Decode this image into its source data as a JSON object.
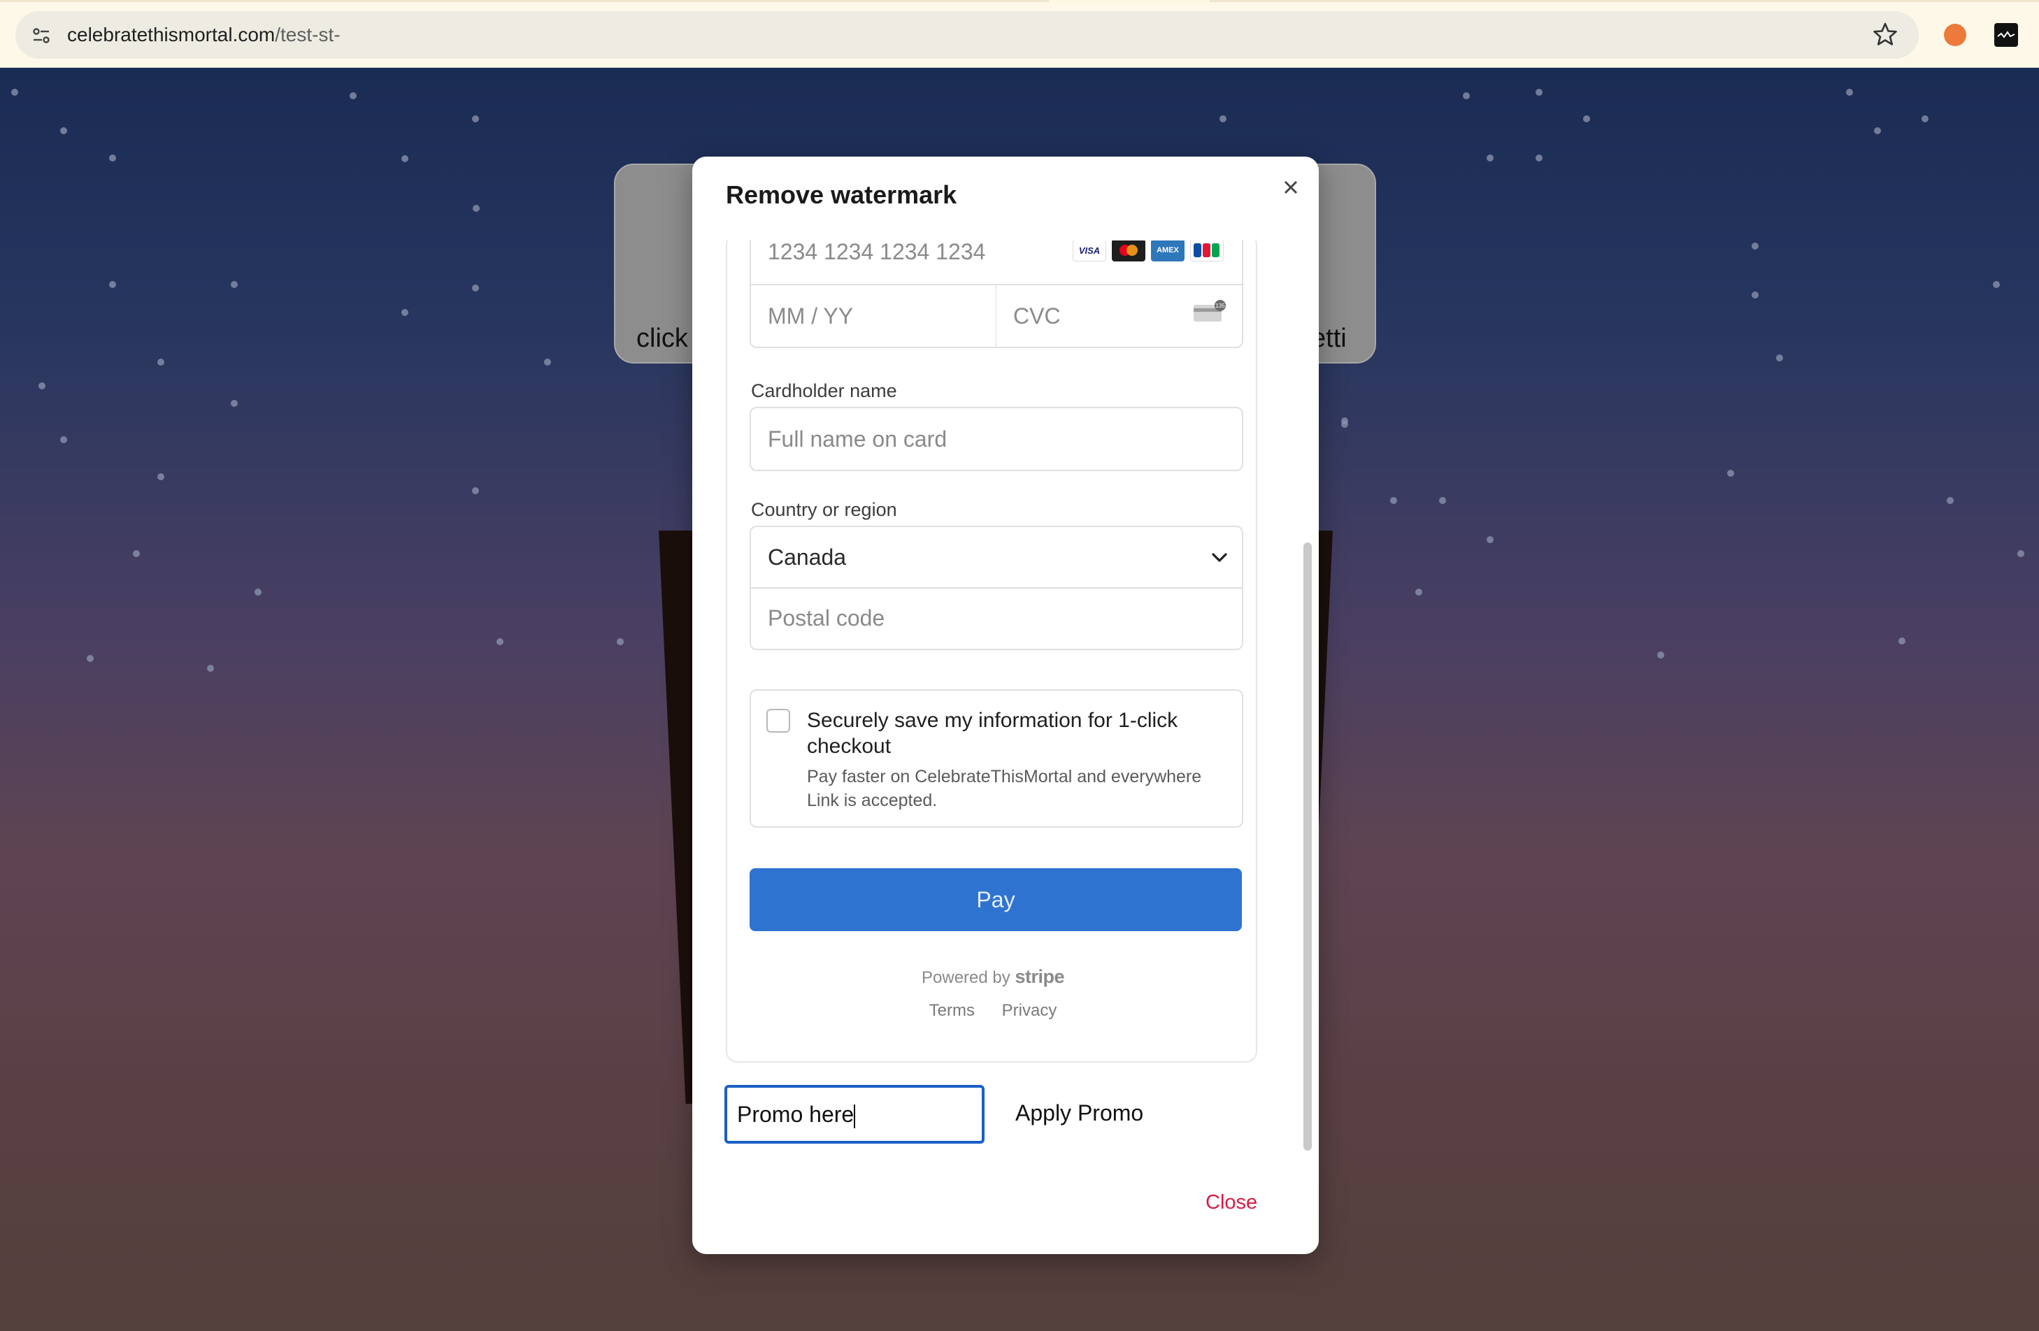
{
  "browser": {
    "url_host": "celebratethismortal.com",
    "url_path": "/test-st-",
    "icons": [
      "site-settings-icon",
      "bookmark-star-icon",
      "extension-icon",
      "extension-icon"
    ]
  },
  "background": {
    "left_text": "click",
    "right_text": "etti"
  },
  "modal": {
    "title": "Remove watermark",
    "card_number_placeholder": "1234 1234 1234 1234",
    "card_brands": [
      "VISA",
      "Mastercard",
      "AMEX",
      "JCB"
    ],
    "expiry_placeholder": "MM / YY",
    "cvc_placeholder": "CVC",
    "cardholder_label": "Cardholder name",
    "cardholder_placeholder": "Full name on card",
    "country_label": "Country or region",
    "country_value": "Canada",
    "postal_placeholder": "Postal code",
    "save_title": "Securely save my information for 1-click checkout",
    "save_subtitle": "Pay faster on CelebrateThisMortal and everywhere Link is accepted.",
    "pay_label": "Pay",
    "powered_by": "Powered by",
    "stripe": "stripe",
    "terms": "Terms",
    "privacy": "Privacy",
    "promo_value": "Promo here",
    "apply_promo": "Apply Promo",
    "close": "Close"
  },
  "colors": {
    "pay_button": "#2f73d0",
    "close_link": "#d81b45",
    "promo_focus": "#1b5fc6"
  }
}
